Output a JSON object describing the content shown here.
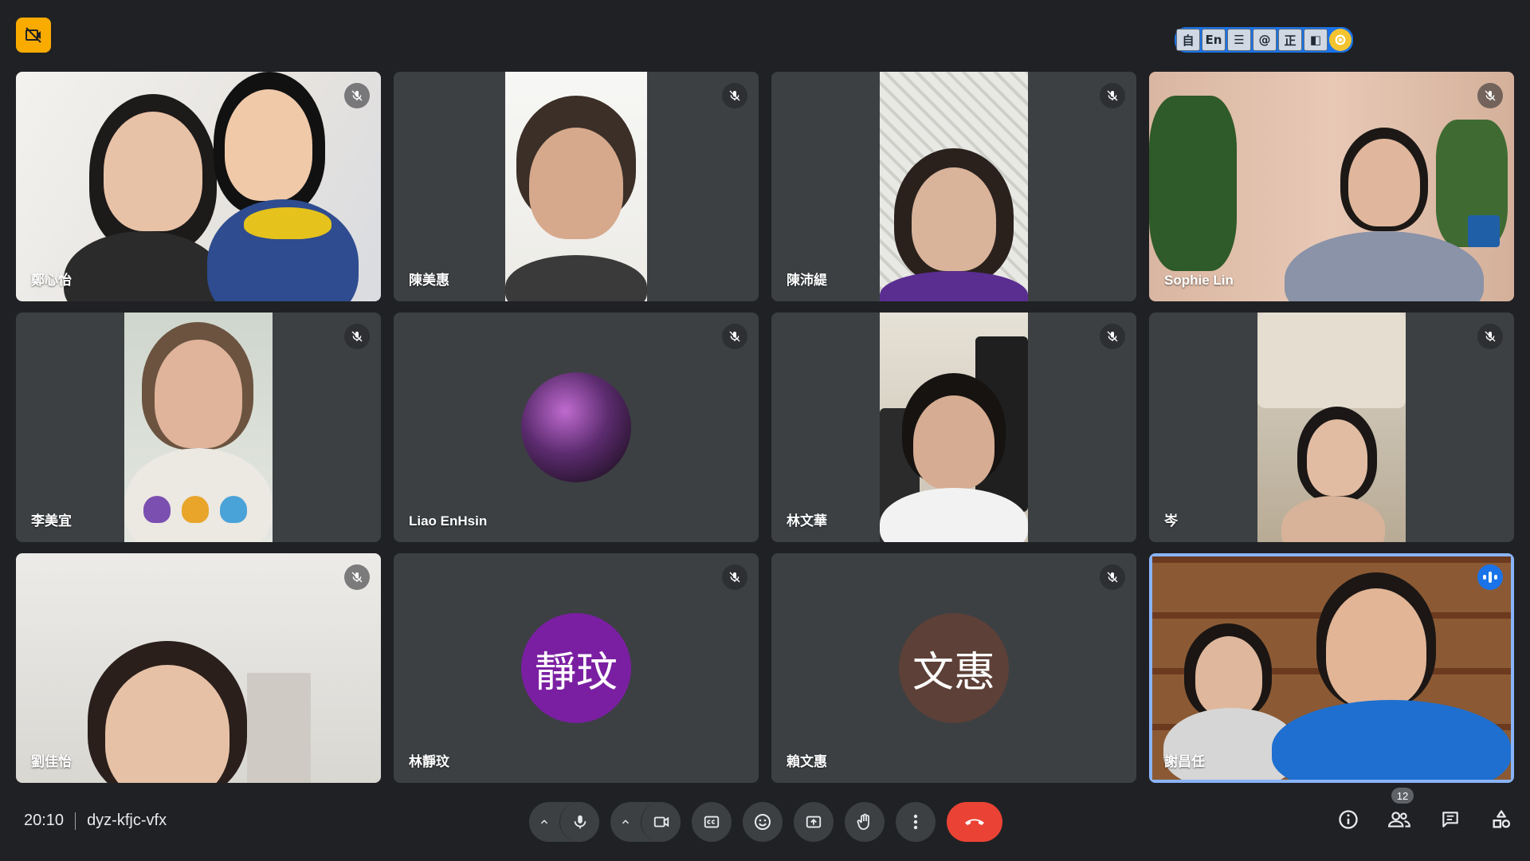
{
  "meeting": {
    "time": "20:10",
    "code": "dyz-kfjc-vfx",
    "participant_count": "12"
  },
  "ime_toolbar": {
    "buttons": [
      "自",
      "En",
      "☰",
      "@",
      "正",
      "◧"
    ]
  },
  "participants": [
    {
      "name": "鄭心怡",
      "muted": true
    },
    {
      "name": "陳美惠",
      "muted": true
    },
    {
      "name": "陳沛緹",
      "muted": true
    },
    {
      "name": "Sophie Lin",
      "muted": true
    },
    {
      "name": "李美宜",
      "muted": true
    },
    {
      "name": "Liao EnHsin",
      "muted": true
    },
    {
      "name": "林文華",
      "muted": true
    },
    {
      "name": "岑",
      "muted": true
    },
    {
      "name": "劉佳怡",
      "muted": true
    },
    {
      "name": "林靜玟",
      "muted": true,
      "avatar_text": "靜玟",
      "avatar_color": "#7b1fa2"
    },
    {
      "name": "賴文惠",
      "muted": true,
      "avatar_text": "文惠",
      "avatar_color": "#5d4037"
    },
    {
      "name": "謝昌任",
      "muted": false,
      "speaking": true
    }
  ],
  "colors": {
    "background": "#202124",
    "tile": "#3c4043",
    "accent": "#8ab4f8",
    "end_call": "#ea4335",
    "recording_badge": "#f9ab00"
  }
}
